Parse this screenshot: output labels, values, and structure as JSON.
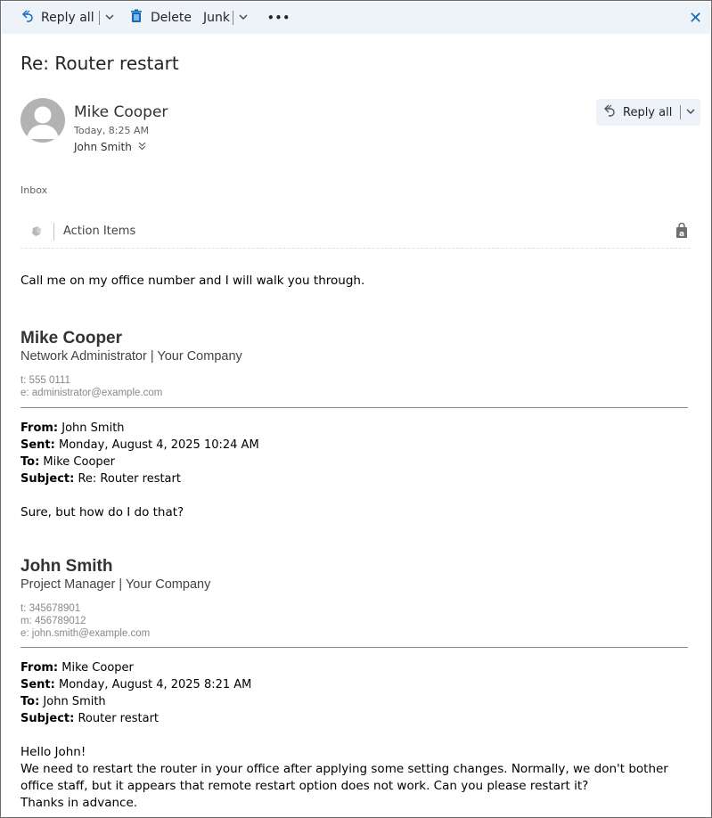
{
  "toolbar": {
    "reply_all": "Reply all",
    "delete": "Delete",
    "junk": "Junk",
    "more": "•••",
    "close": "✕"
  },
  "message": {
    "subject": "Re: Router restart",
    "sender": "Mike Cooper",
    "time": "Today, 8:25 AM",
    "recipient": "John Smith",
    "reply_all_button": "Reply all",
    "folder": "Inbox"
  },
  "action_bar": {
    "label": "Action Items"
  },
  "body": {
    "intro": "Call me on my office number and I will walk you through.",
    "sig1": {
      "name": "Mike Cooper",
      "title": "Network Administrator | Your Company",
      "phone": "t: 555 0111",
      "email": "e: administrator@example.com"
    },
    "quote1": {
      "from_label": "From:",
      "from": " John Smith",
      "sent_label": "Sent:",
      "sent": " Monday, August 4, 2025 10:24 AM",
      "to_label": "To:",
      "to": " Mike Cooper",
      "subject_label": "Subject:",
      "subject": " Re: Router restart",
      "text": "Sure, but how do I do that?"
    },
    "sig2": {
      "name": "John Smith",
      "title": "Project Manager | Your Company",
      "phone": "t: 345678901",
      "mobile": "m: 456789012",
      "email": "e: john.smith@example.com"
    },
    "quote2": {
      "from_label": "From:",
      "from": " Mike Cooper",
      "sent_label": "Sent:",
      "sent": " Monday, August 4, 2025 8:21 AM",
      "to_label": "To:",
      "to": " John Smith",
      "subject_label": "Subject:",
      "subject": " Router restart",
      "greeting": "Hello John!",
      "line1": "We need to restart the router in your office after applying some setting changes. Normally, we don't bother office staff, but it appears that remote restart option does not work. Can you please restart it?",
      "line2": "Thanks in advance."
    }
  },
  "colors": {
    "toolbar_bg": "#eef3fa",
    "accent": "#0f6cbd",
    "avatar": "#b3b3b3"
  },
  "icons": [
    "reply-all-icon",
    "trash-icon",
    "chevron-down-icon",
    "more-icon",
    "close-icon",
    "person-icon",
    "double-chevron-icon",
    "action-items-icon",
    "store-bag-icon"
  ]
}
